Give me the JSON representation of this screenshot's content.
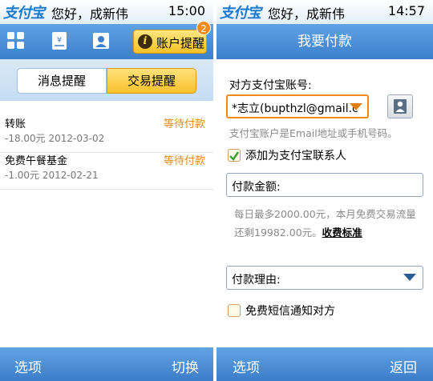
{
  "status": {
    "logo": "支付宝",
    "greeting": "您好，成新伟"
  },
  "left": {
    "time": "15:00",
    "toolbar": {
      "account_button": "账户提醒",
      "badge_count": "2"
    },
    "segments": {
      "messages": "消息提醒",
      "trades": "交易提醒"
    },
    "trades": [
      {
        "title": "转账",
        "amount_date": "-18.00元 2012-03-02",
        "status": "等待付款"
      },
      {
        "title": "免费午餐基金",
        "amount_date": "-1.00元 2012-02-21",
        "status": "等待付款"
      }
    ],
    "bottom": {
      "left": "选项",
      "right": "切换"
    }
  },
  "right": {
    "time": "14:57",
    "title": "我要付款",
    "account_label": "对方支付宝账号:",
    "account_value": "*志立(bupthzl@gmail.c",
    "account_hint": "支付宝账户是Email地址或手机号码。",
    "add_contact": "添加为支付宝联系人",
    "amount_placeholder": "付款金额:",
    "limit_text": "每日最多2000.00元，本月免费交易流量还剩19982.00元。",
    "fee_link": "收费标准",
    "reason_placeholder": "付款理由:",
    "sms_notify": "免费短信通知对方",
    "bottom": {
      "left": "选项",
      "right": "返回"
    }
  },
  "colors": {
    "accent_blue": "#3c7fcc",
    "highlight_yellow": "#f7c12a",
    "pending_orange": "#e58a16"
  }
}
